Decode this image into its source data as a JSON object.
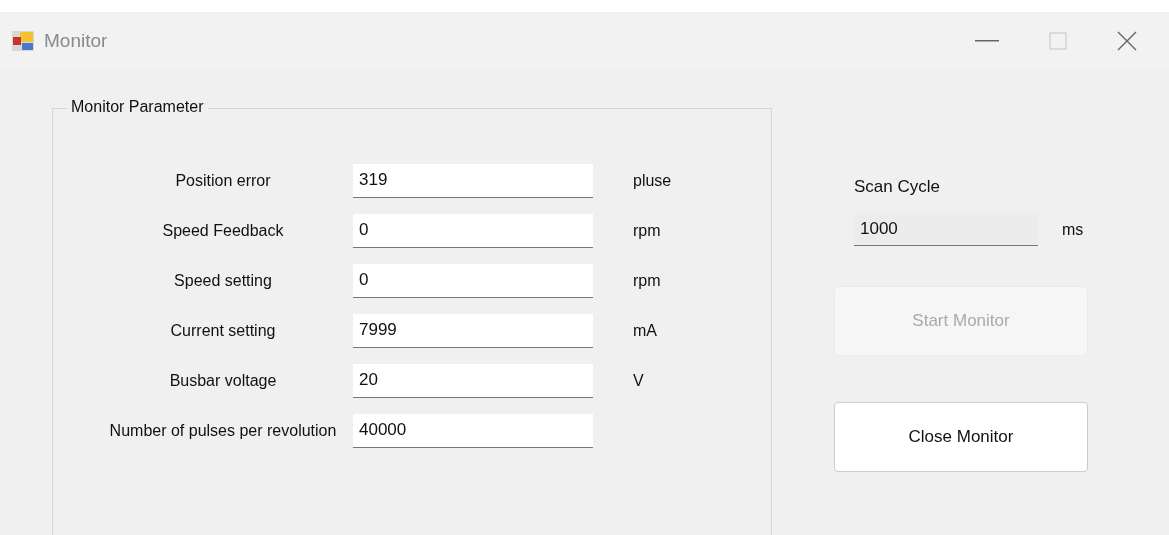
{
  "window": {
    "title": "Monitor",
    "maximize_disabled": true
  },
  "group": {
    "title": "Monitor Parameter",
    "rows": [
      {
        "label": "Position  error",
        "value": "319",
        "unit": "pluse"
      },
      {
        "label": "Speed Feedback",
        "value": "0",
        "unit": "rpm"
      },
      {
        "label": "Speed setting",
        "value": "0",
        "unit": "rpm"
      },
      {
        "label": "Current setting",
        "value": "7999",
        "unit": "mA"
      },
      {
        "label": "Busbar voltage",
        "value": "20",
        "unit": "V"
      },
      {
        "label": "Number of pulses per revolution",
        "value": "40000"
      }
    ]
  },
  "scan": {
    "label": "Scan Cycle",
    "value": "1000",
    "unit": "ms",
    "readonly": true
  },
  "buttons": [
    {
      "label": "Start Monitor",
      "disabled": true
    },
    {
      "label": "Close Monitor",
      "disabled": false
    }
  ]
}
